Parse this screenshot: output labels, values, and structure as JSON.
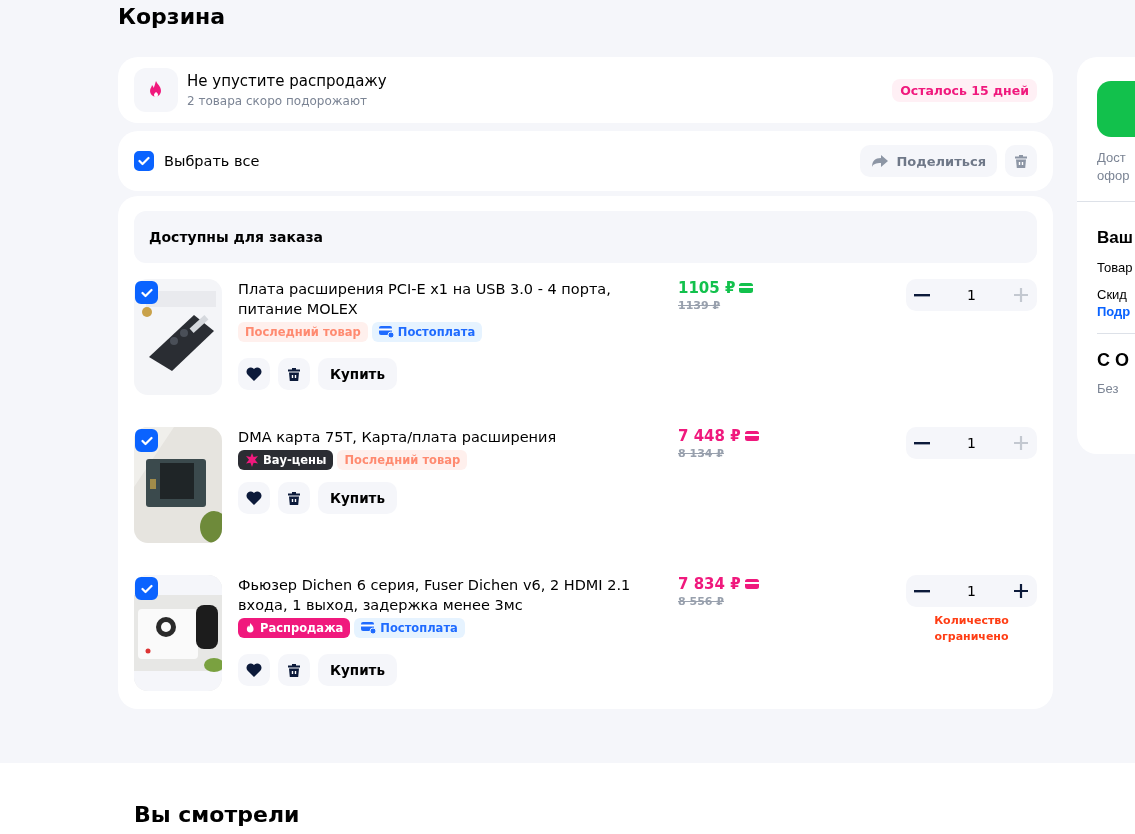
{
  "page_title": "Корзина",
  "promo": {
    "title": "Не упустите распродажу",
    "subtitle": "2 товара скоро подорожают",
    "badge": "Осталось 15 дней"
  },
  "select_all": {
    "label": "Выбрать все",
    "checked": true,
    "share": "Поделиться"
  },
  "section": {
    "title": "Доступны для заказа"
  },
  "items": [
    {
      "checked": true,
      "title": "Плата расширения PCI-E x1 на USB 3.0 - 4 порта, питание MOLEX",
      "badges": [
        {
          "kind": "last",
          "label": "Последний товар"
        },
        {
          "kind": "postpay",
          "label": "Постоплата"
        }
      ],
      "price": "1105 ₽",
      "color": "#12c14c",
      "old_price": "1139 ₽",
      "qty": "1",
      "plus_disabled": true,
      "buy": "Купить"
    },
    {
      "checked": true,
      "title": "DMA карта 75T, Карта/плата расширения",
      "badges": [
        {
          "kind": "wow",
          "label": "Вау-цены"
        },
        {
          "kind": "last",
          "label": "Последний товар"
        }
      ],
      "price": "7 448 ₽",
      "color": "#f0197d",
      "old_price": "8 134 ₽",
      "qty": "1",
      "plus_disabled": true,
      "buy": "Купить"
    },
    {
      "checked": true,
      "title": "Фьюзер Dichen 6 серия, Fuser Dichen v6, 2 HDMI 2.1 входа, 1 выход, задержка менее 3мс",
      "badges": [
        {
          "kind": "sale",
          "label": "Распродажа"
        },
        {
          "kind": "postpay",
          "label": "Постоплата"
        }
      ],
      "price": "7 834 ₽",
      "color": "#f0197d",
      "old_price": "8 556 ₽",
      "qty": "1",
      "plus_disabled": false,
      "note": "Количество ограничено",
      "buy": "Купить"
    }
  ],
  "sidebar": {
    "note_lines": [
      "Дост",
      "офор"
    ],
    "heading": "Ваш",
    "rows": [
      "Товар",
      "Скид"
    ],
    "link": "Подр",
    "heading2": "С О",
    "text2": "Без"
  },
  "viewed_title": "Вы смотрели"
}
